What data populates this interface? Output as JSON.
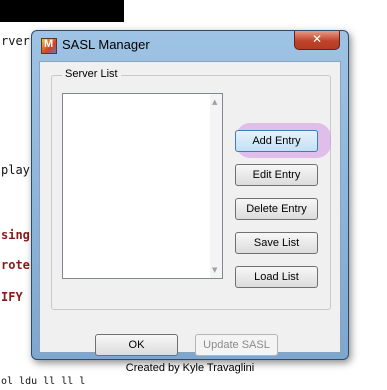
{
  "background": {
    "line1": "rver",
    "line2": "play",
    "line3": "sing",
    "line4": "rote",
    "line5": "IFY",
    "line6": "ol ldu ll ll l"
  },
  "window": {
    "title": "SASL Manager",
    "icon_letter": "M",
    "close_symbol": "✕"
  },
  "group": {
    "label": "Server List"
  },
  "buttons": {
    "add_entry": "Add Entry",
    "edit_entry": "Edit Entry",
    "delete_entry": "Delete Entry",
    "save_list": "Save List",
    "load_list": "Load List",
    "ok": "OK",
    "update_sasl": "Update SASL"
  },
  "footer": {
    "credit": "Created by Kyle Travaglini"
  },
  "scroll": {
    "up": "▲",
    "down": "▼"
  },
  "colors": {
    "highlight": "#d296e6",
    "title_bar": "#9ec3e4",
    "close_button": "#c0432a"
  }
}
